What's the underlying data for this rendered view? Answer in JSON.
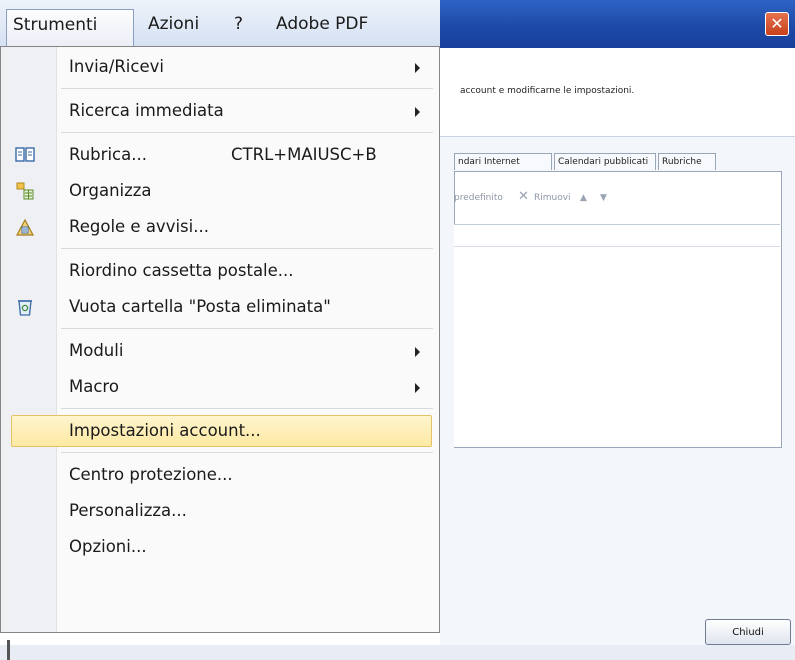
{
  "menubar": {
    "items": [
      {
        "label": "Strumenti",
        "active": true
      },
      {
        "label": "Azioni"
      },
      {
        "label": "?"
      },
      {
        "label": "Adobe PDF"
      }
    ]
  },
  "dropdown": {
    "items": [
      {
        "label": "Invia/Ricevi",
        "submenu": true
      },
      {
        "label": "Ricerca immediata",
        "submenu": true
      },
      {
        "label": "Rubrica...",
        "shortcut": "CTRL+MAIUSC+B",
        "icon": "address-book-icon"
      },
      {
        "label": "Organizza",
        "icon": "organize-icon"
      },
      {
        "label": "Regole e avvisi...",
        "icon": "rules-alerts-icon"
      },
      {
        "label": "Riordino cassetta postale..."
      },
      {
        "label": "Vuota cartella \"Posta eliminata\"",
        "icon": "recycle-bin-icon"
      },
      {
        "label": "Moduli",
        "submenu": true
      },
      {
        "label": "Macro",
        "submenu": true
      },
      {
        "label": "Impostazioni account...",
        "highlighted": true
      },
      {
        "label": "Centro protezione..."
      },
      {
        "label": "Personalizza..."
      },
      {
        "label": "Opzioni..."
      }
    ]
  },
  "dialog": {
    "close_glyph": "✕",
    "description": "account e modificarne le impostazioni.",
    "tabs": [
      "ndari Internet",
      "Calendari pubblicati",
      "Rubriche"
    ],
    "toolbar": {
      "default_label": "predefinito",
      "remove_label": "Rimuovi"
    },
    "close_button": "Chiudi"
  },
  "colors": {
    "highlight": "#fde9a2",
    "titlebar": "#1d4aa8",
    "menubar": "#d5e1f2"
  }
}
